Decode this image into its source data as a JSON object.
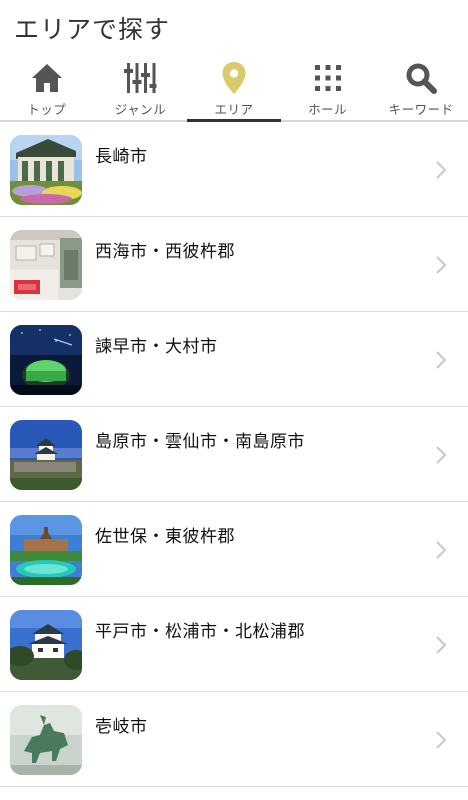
{
  "page": {
    "title": "エリアで探す"
  },
  "tabs": [
    {
      "label": "トップ",
      "icon": "home-icon"
    },
    {
      "label": "ジャンル",
      "icon": "sliders-icon"
    },
    {
      "label": "エリア",
      "icon": "map-pin-icon",
      "active": true
    },
    {
      "label": "ホール",
      "icon": "grid-icon"
    },
    {
      "label": "キーワード",
      "icon": "search-icon"
    }
  ],
  "colors": {
    "active_icon": "#d8cc6a",
    "inactive_icon": "#555555",
    "divider": "#dcdcdc"
  },
  "areas": [
    {
      "name": "長崎市",
      "thumb": "glover-garden-photo"
    },
    {
      "name": "西海市・西彼杵郡",
      "thumb": "museum-interior-photo"
    },
    {
      "name": "諫早市・大村市",
      "thumb": "planetarium-night-photo"
    },
    {
      "name": "島原市・雲仙市・南島原市",
      "thumb": "shimabara-castle-photo"
    },
    {
      "name": "佐世保・東彼杵郡",
      "thumb": "huis-ten-bosch-photo"
    },
    {
      "name": "平戸市・松浦市・北松浦郡",
      "thumb": "hirado-castle-photo"
    },
    {
      "name": "壱岐市",
      "thumb": "horse-statue-photo"
    }
  ]
}
